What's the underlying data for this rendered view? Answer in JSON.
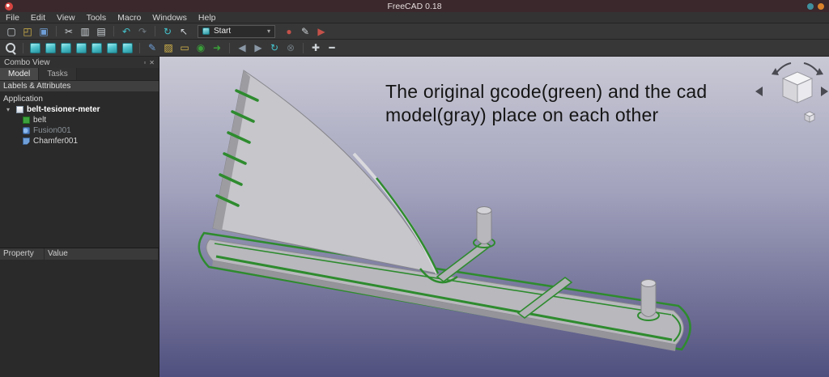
{
  "titlebar": {
    "title": "FreeCAD 0.18"
  },
  "menubar": {
    "items": [
      {
        "label": "File",
        "name": "menu-file"
      },
      {
        "label": "Edit",
        "name": "menu-edit"
      },
      {
        "label": "View",
        "name": "menu-view"
      },
      {
        "label": "Tools",
        "name": "menu-tools"
      },
      {
        "label": "Macro",
        "name": "menu-macro"
      },
      {
        "label": "Windows",
        "name": "menu-windows"
      },
      {
        "label": "Help",
        "name": "menu-help"
      }
    ]
  },
  "toolbar": {
    "workbench": {
      "selected": "Start",
      "chevron": "▾"
    },
    "row1a": [
      {
        "name": "new-file-icon",
        "glyph": "▢",
        "cls": "c-plain"
      },
      {
        "name": "open-file-icon",
        "glyph": "◰",
        "cls": "c-yellow"
      },
      {
        "name": "save-icon",
        "glyph": "▣",
        "cls": "c-blue"
      },
      {
        "name": "toolbar-separator",
        "glyph": "",
        "cls": "sep"
      },
      {
        "name": "cut-icon",
        "glyph": "✂",
        "cls": "c-plain"
      },
      {
        "name": "copy-icon",
        "glyph": "▥",
        "cls": "c-plain"
      },
      {
        "name": "paste-icon",
        "glyph": "▤",
        "cls": "c-plain"
      },
      {
        "name": "toolbar-separator",
        "glyph": "",
        "cls": "sep"
      },
      {
        "name": "undo-icon",
        "glyph": "↶",
        "cls": "c-teal"
      },
      {
        "name": "redo-icon",
        "glyph": "↷",
        "cls": "c-dim"
      },
      {
        "name": "toolbar-separator",
        "glyph": "",
        "cls": "sep"
      },
      {
        "name": "refresh-icon",
        "glyph": "↻",
        "cls": "c-teal"
      },
      {
        "name": "select-icon",
        "glyph": "↖",
        "cls": "c-plain"
      }
    ],
    "row1b": [
      {
        "name": "macro-record-icon",
        "glyph": "●",
        "cls": "c-red"
      },
      {
        "name": "macro-edit-icon",
        "glyph": "✎",
        "cls": "c-plain"
      },
      {
        "name": "macro-play-icon",
        "glyph": "▶",
        "cls": "c-red"
      }
    ],
    "row2": [
      {
        "name": "zoom-icon",
        "glyph": "",
        "cls": "magnifier"
      },
      {
        "name": "toolbar-separator",
        "glyph": "",
        "cls": "sep"
      },
      {
        "name": "view-fit-icon",
        "glyph": "",
        "cls": "cube"
      },
      {
        "name": "view-axonometric-icon",
        "glyph": "",
        "cls": "cube"
      },
      {
        "name": "view-front-icon",
        "glyph": "",
        "cls": "cube"
      },
      {
        "name": "view-top-icon",
        "glyph": "",
        "cls": "cube"
      },
      {
        "name": "view-right-icon",
        "glyph": "",
        "cls": "cube"
      },
      {
        "name": "view-rear-icon",
        "glyph": "",
        "cls": "cube"
      },
      {
        "name": "view-bottom-icon",
        "glyph": "",
        "cls": "cube"
      },
      {
        "name": "toolbar-separator",
        "glyph": "",
        "cls": "sep"
      },
      {
        "name": "measure-icon",
        "glyph": "✎",
        "cls": "c-blue"
      },
      {
        "name": "clipping-icon",
        "glyph": "▨",
        "cls": "c-yellow"
      },
      {
        "name": "texture-icon",
        "glyph": "▭",
        "cls": "c-yellow"
      },
      {
        "name": "scene-icon",
        "glyph": "◉",
        "cls": "c-green"
      },
      {
        "name": "link-icon",
        "glyph": "➜",
        "cls": "c-green"
      },
      {
        "name": "toolbar-separator",
        "glyph": "",
        "cls": "sep"
      },
      {
        "name": "nav-back-icon",
        "glyph": "◀",
        "cls": "c-steel"
      },
      {
        "name": "nav-forward-icon",
        "glyph": "▶",
        "cls": "c-steel"
      },
      {
        "name": "sync-icon",
        "glyph": "↻",
        "cls": "c-teal"
      },
      {
        "name": "abort-icon",
        "glyph": "⊗",
        "cls": "c-dim"
      },
      {
        "name": "toolbar-separator",
        "glyph": "",
        "cls": "sep"
      },
      {
        "name": "zoom-in-icon",
        "glyph": "✚",
        "cls": "c-plain"
      },
      {
        "name": "zoom-out-icon",
        "glyph": "━",
        "cls": "c-plain"
      }
    ]
  },
  "combo_view": {
    "title": "Combo View",
    "float_icon": "▫",
    "close_icon": "✕",
    "tabs": [
      "Model",
      "Tasks"
    ],
    "labels_header": "Labels & Attributes",
    "application_label": "Application",
    "expander_glyph": "▾",
    "tree": [
      {
        "label": "belt-tesioner-meter"
      },
      {
        "label": "belt"
      },
      {
        "label": "Fusion001"
      },
      {
        "label": "Chamfer001"
      }
    ],
    "property_columns": [
      "Property",
      "Value"
    ]
  },
  "viewport": {
    "annotation_line1": "The original gcode(green) and the cad",
    "annotation_line2": "model(gray) place on each other",
    "colors": {
      "gcode_green": "#2e8b2e",
      "model_gray": "#c3c3c8",
      "background_top": "#c9c9d5",
      "background_bottom": "#50507f"
    }
  }
}
